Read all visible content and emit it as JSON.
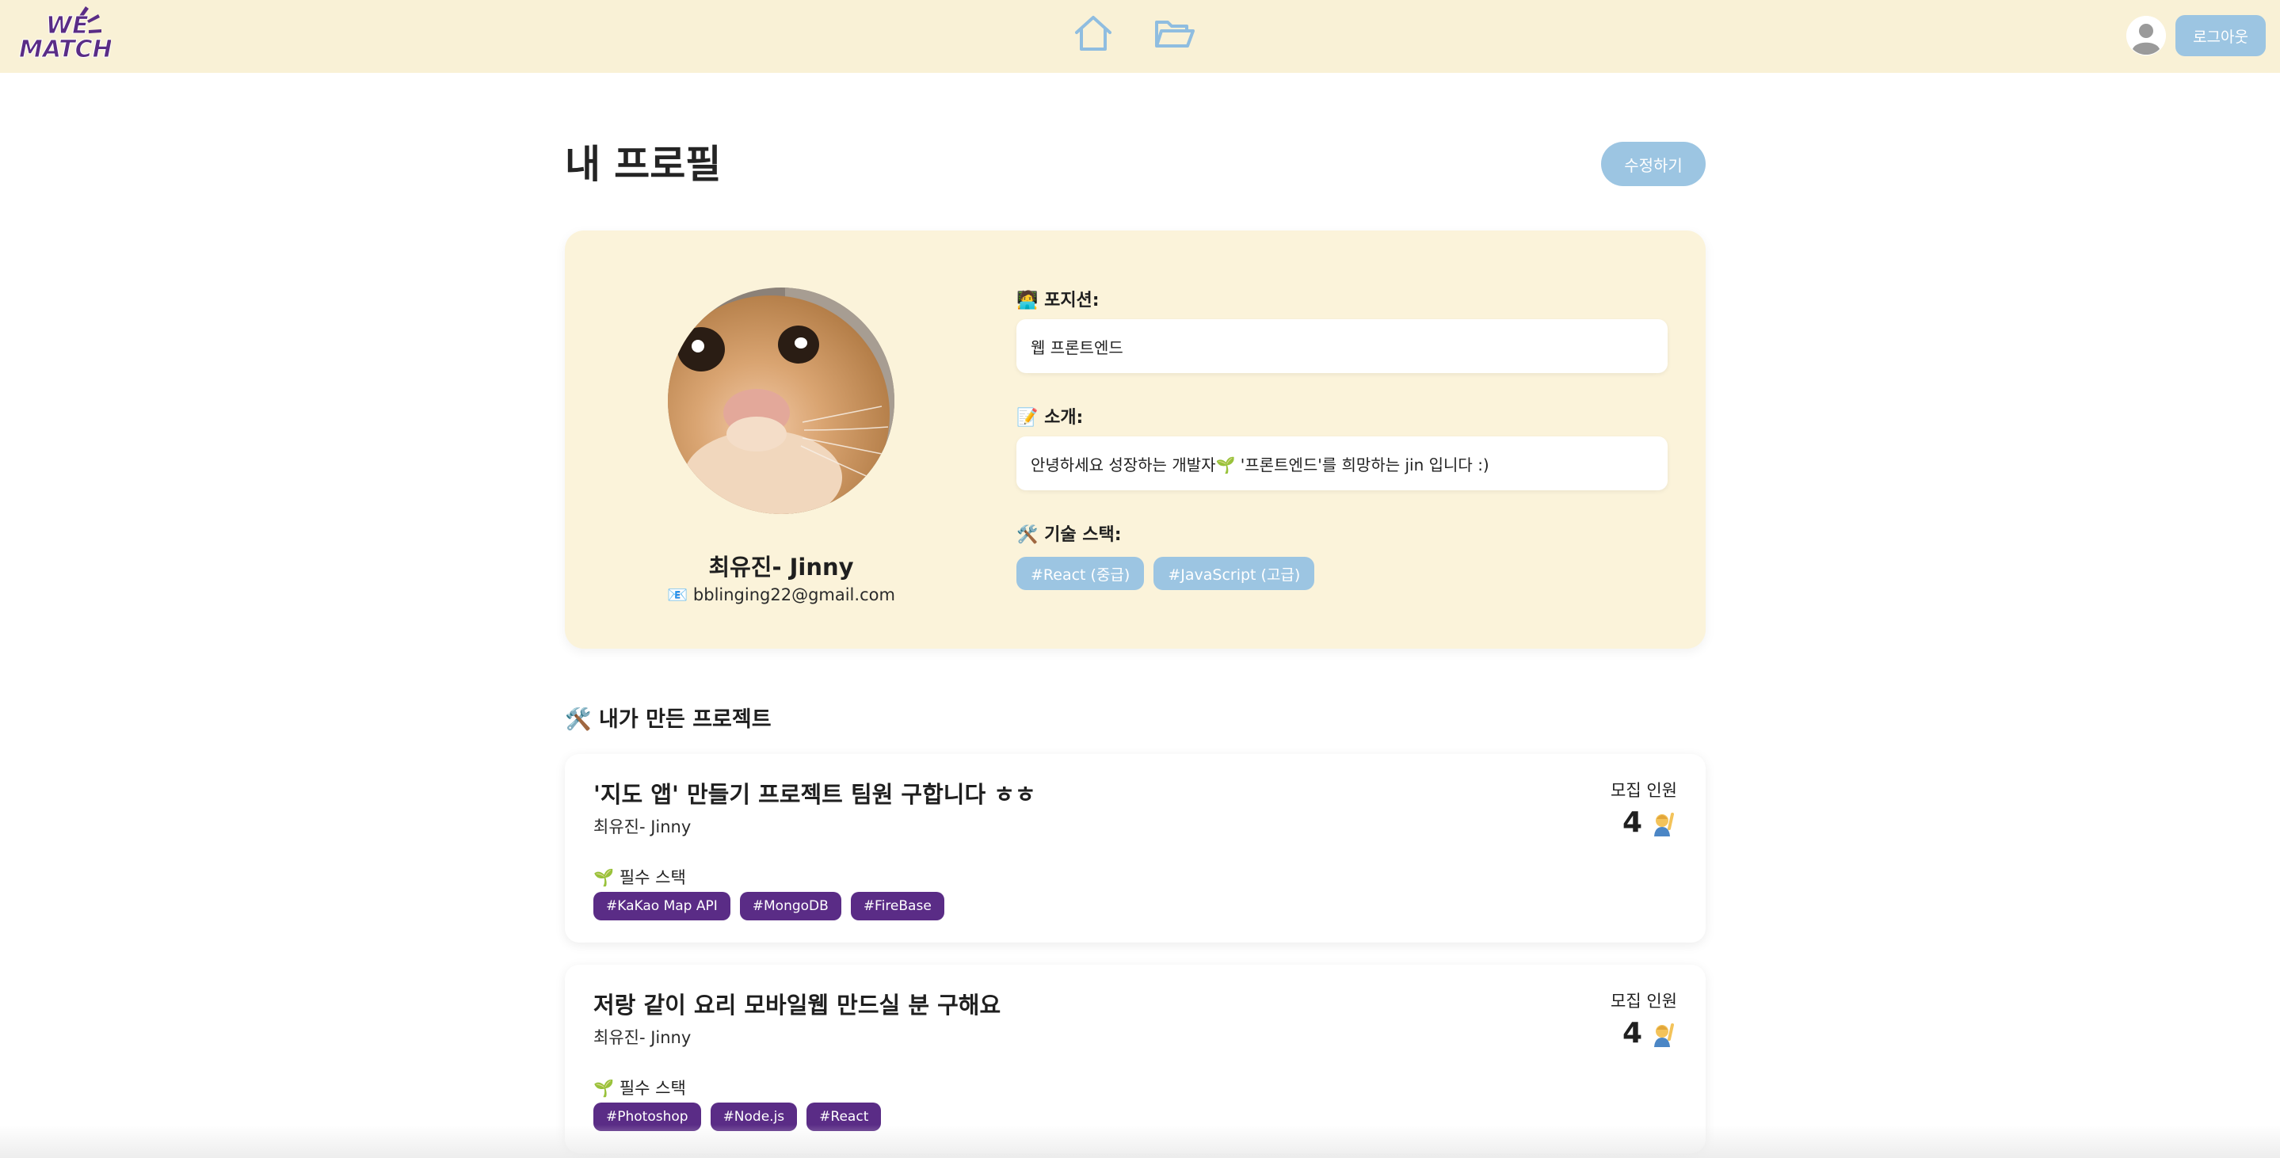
{
  "header": {
    "logo_text_line1": "WE",
    "logo_text_line2": "MATCH",
    "home_icon": "home-icon",
    "folder_icon": "folder-icon",
    "avatar_icon": "user-avatar-icon",
    "logout_label": "로그아웃",
    "colors": {
      "background": "#f9f1d6",
      "accent": "#9cc5e2",
      "logo": "#5a2c86"
    }
  },
  "page": {
    "title": "내 프로필",
    "edit_label": "수정하기"
  },
  "profile": {
    "name": "최유진- Jinny",
    "email_icon": "📧",
    "email": "bblinging22@gmail.com",
    "position_icon": "🧑‍💻",
    "position_label": "포지션:",
    "position_value": "웹 프론트엔드",
    "intro_icon": "📝",
    "intro_label": "소개:",
    "intro_value": "안녕하세요 성장하는 개발자🌱 '프론트엔드'를 희망하는 jin 입니다 :)",
    "skills_icon": "🛠️",
    "skills_label": "기술 스택:",
    "skills": [
      "#React (중급)",
      "#JavaScript (고급)"
    ],
    "card_color": "#fbf3da"
  },
  "projects": {
    "section_icon": "🛠️",
    "section_title": "내가 만든 프로젝트",
    "items": [
      {
        "title": "'지도 앱' 만들기 프로젝트 팀원 구합니다 ㅎㅎ",
        "author": "최유진- Jinny",
        "stack_icon": "🌱",
        "stack_label": "필수 스택",
        "tags": [
          "#KaKao Map API",
          "#MongoDB",
          "#FireBase"
        ],
        "recruit_label": "모집 인원",
        "recruit_count": "4",
        "recruit_icon": "person-raising-hand-icon"
      },
      {
        "title": "저랑 같이 요리 모바일웹 만드실 분 구해요",
        "author": "최유진- Jinny",
        "stack_icon": "🌱",
        "stack_label": "필수 스택",
        "tags": [
          "#Photoshop",
          "#Node.js",
          "#React"
        ],
        "recruit_label": "모집 인원",
        "recruit_count": "4",
        "recruit_icon": "person-raising-hand-icon"
      }
    ],
    "tag_color": "#5a2c86"
  }
}
